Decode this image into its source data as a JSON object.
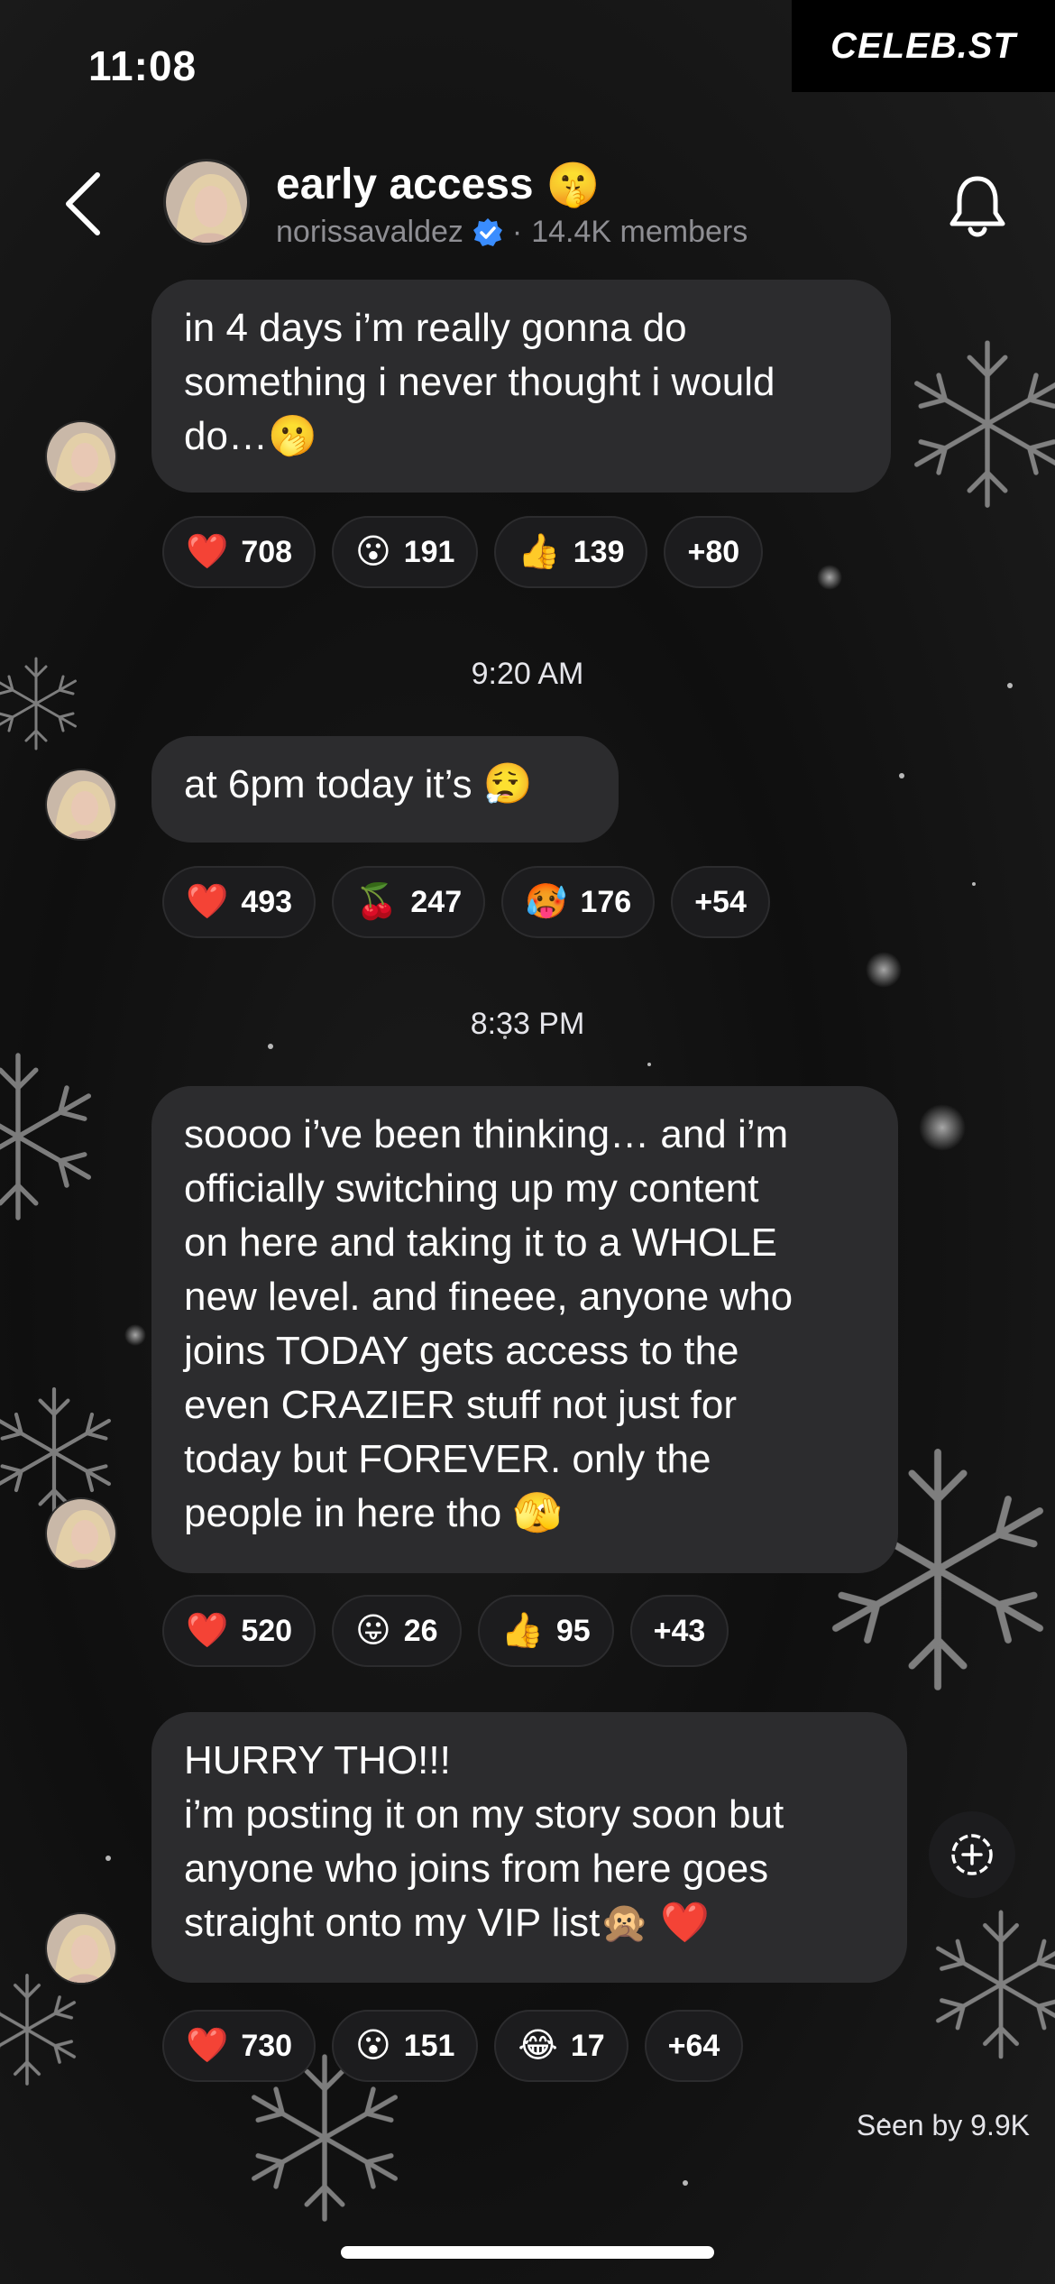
{
  "status_bar": {
    "time": "11:08"
  },
  "brand": "CELEB.ST",
  "header": {
    "title": "early access",
    "title_emoji": "🤫",
    "username": "norissavaldez",
    "separator": "·",
    "members": "14.4K members"
  },
  "messages": [
    {
      "text": "in 4 days i’m really gonna do\nsomething i never thought i would\ndo…🫢",
      "reactions": [
        {
          "emoji": "❤️",
          "count": "708"
        },
        {
          "emoji": "😮",
          "count": "191"
        },
        {
          "emoji": "👍",
          "count": "139"
        }
      ],
      "more": "+80"
    },
    {
      "timestamp": "9:20 AM",
      "text": "at 6pm today it’s 😮‍💨",
      "reactions": [
        {
          "emoji": "❤️",
          "count": "493"
        },
        {
          "emoji": "🍒",
          "count": "247"
        },
        {
          "emoji": "🥵",
          "count": "176"
        }
      ],
      "more": "+54"
    },
    {
      "timestamp": "8:33 PM",
      "text": "soooo i’ve been thinking… and i’m\nofficially switching up my content\non here and taking it to a WHOLE\nnew level. and fineee, anyone who\njoins TODAY gets access to the\neven CRAZIER stuff not just for\ntoday but FOREVER. only the\npeople in here tho 🫣",
      "reactions": [
        {
          "emoji": "❤️",
          "count": "520"
        },
        {
          "emoji": "😛",
          "count": "26"
        },
        {
          "emoji": "👍",
          "count": "95"
        }
      ],
      "more": "+43"
    },
    {
      "text": "HURRY THO!!!\ni’m posting it on my story soon but\nanyone who joins from here goes\nstraight onto my VIP list🙊 ❤️",
      "reactions": [
        {
          "emoji": "❤️",
          "count": "730"
        },
        {
          "emoji": "😮",
          "count": "151"
        },
        {
          "emoji": "😂",
          "count": "17"
        }
      ],
      "more": "+64"
    }
  ],
  "seen_by": "Seen by 9.9K",
  "colors": {
    "bubble": "#2c2c2e",
    "chip": "#1c1c1e",
    "verified": "#3a8dff",
    "muted": "#8e8e93"
  }
}
